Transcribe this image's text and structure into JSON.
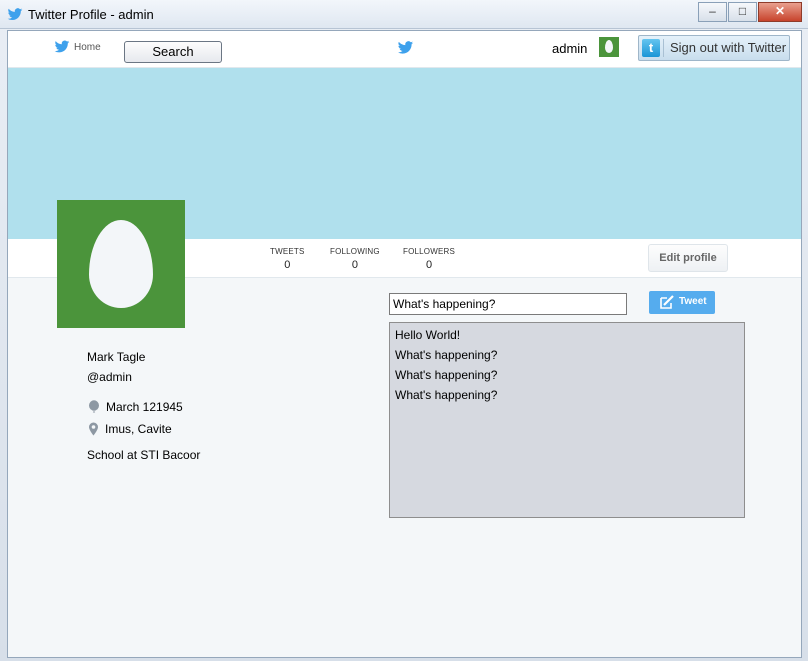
{
  "window": {
    "title": "Twitter Profile - admin",
    "controls": {
      "minimize": "–",
      "maximize": "□",
      "close": "✕"
    }
  },
  "topbar": {
    "home_label": "Home",
    "search_label": "Search",
    "username": "admin",
    "signout_label": "Sign out with Twitter",
    "signout_icon_letter": "t"
  },
  "stats": {
    "tweets_label": "TWEETS",
    "tweets_value": "0",
    "following_label": "FOLLOWING",
    "following_value": "0",
    "followers_label": "FOLLOWERS",
    "followers_value": "0",
    "edit_label": "Edit profile"
  },
  "profile": {
    "name": "Mark Tagle",
    "handle": "@admin",
    "birthday": "March 121945",
    "location": "Imus, Cavite",
    "bio": "School at STI Bacoor"
  },
  "composer": {
    "input_value": "What's happening?",
    "tweet_label": "Tweet"
  },
  "feed": {
    "items": [
      "Hello World!",
      "What's happening?",
      "What's happening?",
      "What's happening?"
    ]
  },
  "colors": {
    "banner": "#b0e0ed",
    "avatar": "#4b943b",
    "brand_blue": "#55acee",
    "page_bg": "#f4f7f9",
    "feed_bg": "#d6d9e0"
  },
  "icons": {
    "app": "twitter-bird-icon",
    "home": "twitter-bird-icon",
    "center": "twitter-bird-icon",
    "birthday": "balloon-icon",
    "location": "map-pin-icon",
    "tweet": "compose-icon"
  }
}
